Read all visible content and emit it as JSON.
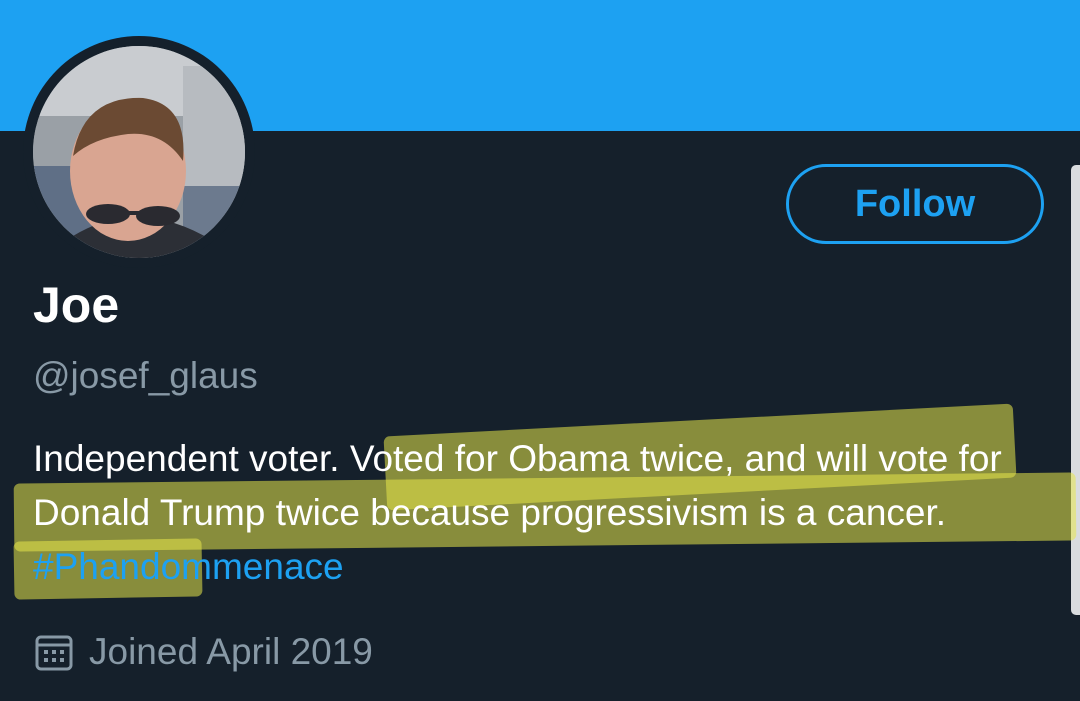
{
  "profile": {
    "display_name": "Joe",
    "handle": "@josef_glaus",
    "bio": {
      "plain": "Independent voter. ",
      "highlighted": "Voted for Obama twice, and will vote for Donald Trump twice because progressivism is a cancer.",
      "hashtag": "#Phandommenace"
    },
    "joined": "Joined April 2019"
  },
  "actions": {
    "follow_label": "Follow"
  },
  "icons": {
    "avatar": "profile-photo",
    "calendar": "calendar-icon"
  },
  "colors": {
    "background": "#15202b",
    "banner": "#1da1f2",
    "accent": "#1da1f2",
    "primary_text": "#ffffff",
    "secondary_text": "#8899a6",
    "highlighter": "#e8e84a"
  }
}
